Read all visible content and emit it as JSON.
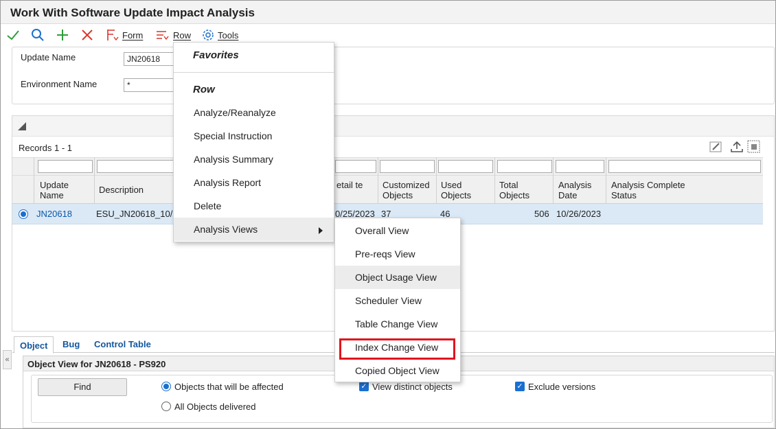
{
  "window": {
    "title": "Work With Software Update Impact Analysis"
  },
  "toolbar": {
    "form_label": "Form",
    "row_label": "Row",
    "tools_label": "Tools"
  },
  "search_form": {
    "update_name_label": "Update Name",
    "update_name_value": "JN20618",
    "environment_label": "Environment Name",
    "environment_value": "*"
  },
  "grid": {
    "records_label": "Records 1 - 1",
    "headers": {
      "update_name": "Update Name",
      "description": "Description",
      "detail_date_partial": "etail te",
      "customized_objects": "Customized Objects",
      "used_objects": "Used Objects",
      "total_objects": "Total Objects",
      "analysis_date": "Analysis Date",
      "analysis_status": "Analysis Complete Status"
    },
    "row": {
      "update_name": "JN20618",
      "description": "ESU_JN20618_10/2",
      "detail_date": "0/25/2023",
      "customized_objects": "37",
      "used_objects": "46",
      "total_objects": "506",
      "analysis_date": "10/26/2023",
      "analysis_status": ""
    }
  },
  "tabs": [
    "Object",
    "Bug",
    "Control Table"
  ],
  "object_view": {
    "title": "Object View for JN20618 - PS920",
    "find_label": "Find",
    "radio_affected": "Objects that will be affected",
    "radio_all": "All Objects delivered",
    "check_distinct": "View distinct objects",
    "check_exclude": "Exclude versions"
  },
  "row_menu": {
    "favorites_header": "Favorites",
    "row_header": "Row",
    "items": [
      "Analyze/Reanalyze",
      "Special Instruction",
      "Analysis Summary",
      "Analysis Report",
      "Delete",
      "Analysis Views"
    ]
  },
  "analysis_views_submenu": {
    "items": [
      "Overall View",
      "Pre-reqs View",
      "Object Usage View",
      "Scheduler View",
      "Table Change View",
      "Index Change View",
      "Copied Object View"
    ]
  },
  "colors": {
    "accent": "#1a6fd0",
    "link": "#0b57a6",
    "highlight_box": "#e0141c",
    "ok_green": "#2e9d3a",
    "cancel_red": "#d9342b"
  }
}
